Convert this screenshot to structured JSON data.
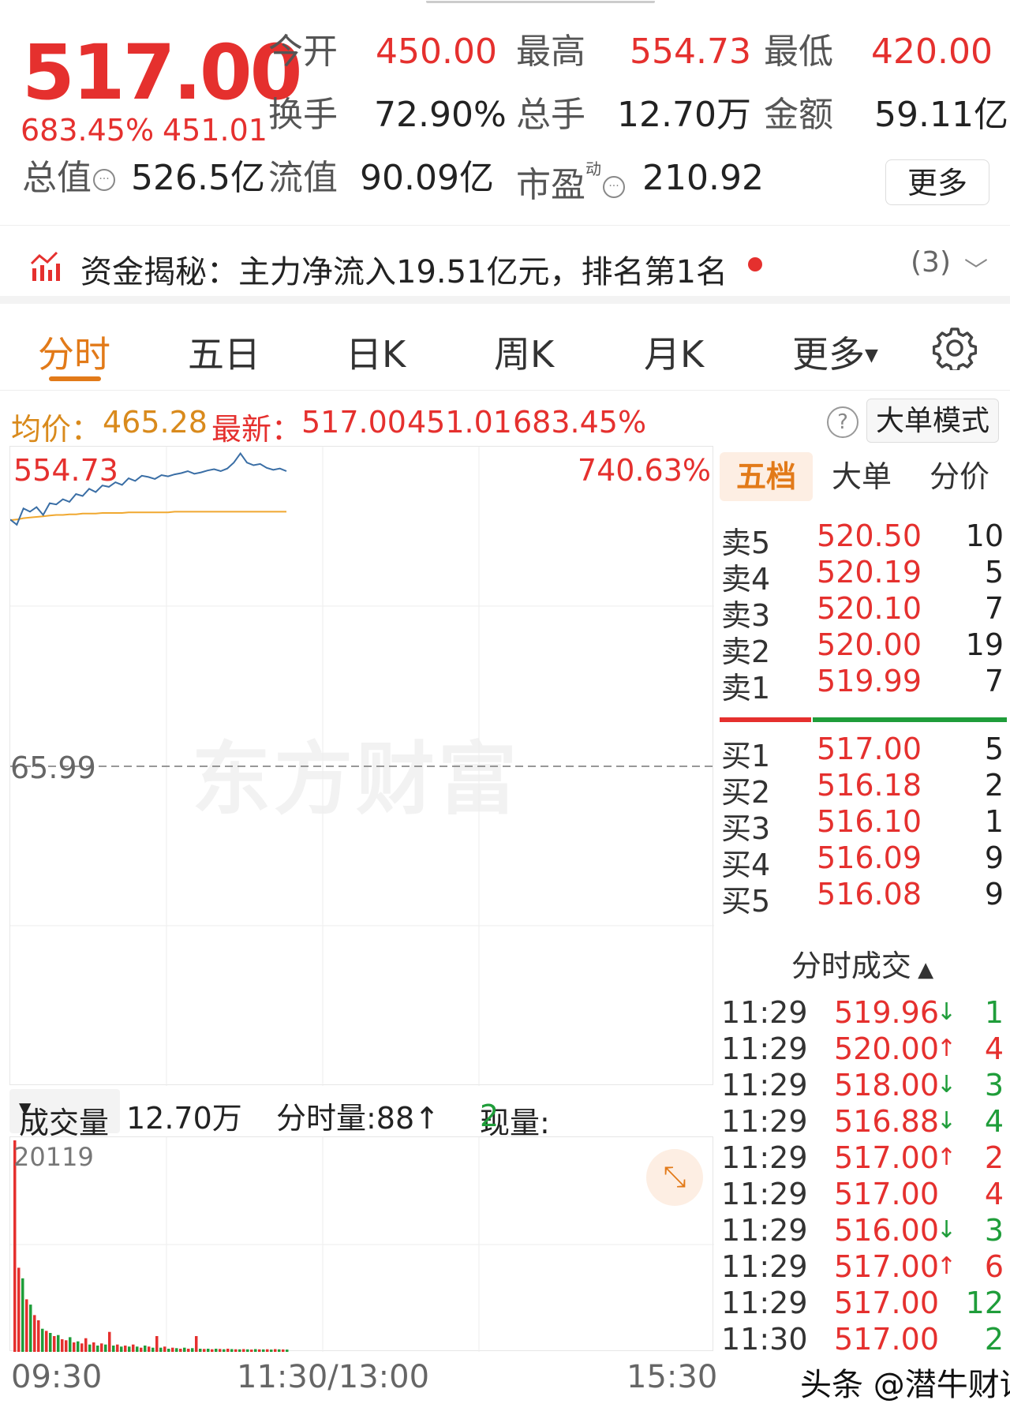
{
  "quote": {
    "price": "517.00",
    "change_pct": "683.45%",
    "change_abs": "451.01",
    "open_label": "今开",
    "open": "450.00",
    "high_label": "最高",
    "high": "554.73",
    "low_label": "最低",
    "low": "420.00",
    "turnover_label": "换手",
    "turnover": "72.90%",
    "volume_label": "总手",
    "volume": "12.70万",
    "amount_label": "金额",
    "amount": "59.11亿",
    "mktcap_label": "总值",
    "mktcap": "526.5亿",
    "float_label": "流值",
    "float": "90.09亿",
    "pe_label": "市盈",
    "pe_sup": "动",
    "pe": "210.92",
    "more_label": "更多"
  },
  "flow": {
    "text": "资金揭秘：主力净流入19.51亿元，排名第1名",
    "count": "(3)"
  },
  "tabs": [
    "分时",
    "五日",
    "日K",
    "周K",
    "月K",
    "更多"
  ],
  "strip": {
    "avg_label": "均价：",
    "avg": "465.28",
    "latest_label": "最新：",
    "latest": "517.00",
    "latest_chg": "451.01",
    "latest_pct": "683.45%",
    "mode_label": "大单模式"
  },
  "chart_labels": {
    "y_top": "554.73",
    "y_top_pct": "740.63%",
    "y_mid": "65.99",
    "watermark": "东方财富"
  },
  "volume_header": {
    "label": "成交量",
    "total": "12.70万",
    "period_vol": "分时量:88↑",
    "current_label": "现量:",
    "current": "2",
    "max": "20119"
  },
  "time_axis": [
    "09:30",
    "11:30/13:00",
    "15:30"
  ],
  "panel": {
    "tabs": [
      "五档",
      "大单",
      "分价"
    ],
    "asks": [
      {
        "label": "卖5",
        "price": "520.50",
        "qty": "10"
      },
      {
        "label": "卖4",
        "price": "520.19",
        "qty": "5"
      },
      {
        "label": "卖3",
        "price": "520.10",
        "qty": "7"
      },
      {
        "label": "卖2",
        "price": "520.00",
        "qty": "19"
      },
      {
        "label": "卖1",
        "price": "519.99",
        "qty": "7"
      }
    ],
    "bids": [
      {
        "label": "买1",
        "price": "517.00",
        "qty": "5"
      },
      {
        "label": "买2",
        "price": "516.18",
        "qty": "2"
      },
      {
        "label": "买3",
        "price": "516.10",
        "qty": "1"
      },
      {
        "label": "买4",
        "price": "516.09",
        "qty": "9"
      },
      {
        "label": "买5",
        "price": "516.08",
        "qty": "9"
      }
    ],
    "ticks_title": "分时成交",
    "ticks": [
      {
        "time": "11:29",
        "price": "519.96",
        "dir": "down",
        "qty": "1",
        "side": "buy"
      },
      {
        "time": "11:29",
        "price": "520.00",
        "dir": "up",
        "qty": "4",
        "side": "sell"
      },
      {
        "time": "11:29",
        "price": "518.00",
        "dir": "down",
        "qty": "3",
        "side": "buy"
      },
      {
        "time": "11:29",
        "price": "516.88",
        "dir": "down",
        "qty": "4",
        "side": "buy"
      },
      {
        "time": "11:29",
        "price": "517.00",
        "dir": "up",
        "qty": "2",
        "side": "sell"
      },
      {
        "time": "11:29",
        "price": "517.00",
        "dir": "",
        "qty": "4",
        "side": "sell"
      },
      {
        "time": "11:29",
        "price": "516.00",
        "dir": "down",
        "qty": "3",
        "side": "buy"
      },
      {
        "time": "11:29",
        "price": "517.00",
        "dir": "up",
        "qty": "6",
        "side": "sell"
      },
      {
        "time": "11:29",
        "price": "517.00",
        "dir": "",
        "qty": "12",
        "side": "buy"
      },
      {
        "time": "11:30",
        "price": "517.00",
        "dir": "",
        "qty": "2",
        "side": "buy"
      }
    ],
    "depth_bid_ratio": 0.32
  },
  "credit": "头条 @潜牛财评",
  "colors": {
    "up": "#e5302e",
    "down": "#1f9d3a",
    "accent": "#e27a19",
    "price_line": "#3a6ea5",
    "avg_line": "#f0a830"
  },
  "chart_data": {
    "type": "line",
    "x_start": "09:30",
    "x_end": "15:30",
    "ylim": [
      65.99,
      554.73
    ],
    "series": [
      {
        "values": [
          453,
          445,
          470,
          465,
          472,
          460,
          478,
          476,
          484,
          480,
          492,
          489,
          500,
          495,
          505,
          503,
          510,
          506,
          516,
          512,
          520,
          518,
          515,
          521,
          519,
          522,
          524,
          527,
          523,
          525,
          528,
          530,
          527,
          531,
          540,
          554,
          540,
          536,
          538,
          532,
          529,
          531,
          527
        ]
      },
      {
        "values": [
          452,
          453,
          455,
          456,
          457,
          458,
          459,
          460,
          460,
          461,
          461,
          462,
          462,
          462,
          463,
          463,
          463,
          463,
          464,
          464,
          464,
          464,
          464,
          464,
          464,
          465,
          465,
          465,
          465,
          465,
          465,
          465,
          465,
          465,
          465,
          465,
          465,
          465,
          465,
          465,
          465,
          465,
          465
        ]
      }
    ],
    "volume": {
      "max": 20119,
      "values": [
        20119,
        8000,
        7000,
        5000,
        4500,
        3500,
        3000,
        2200,
        2000,
        1800,
        1500,
        1600,
        1200,
        1100,
        1400,
        900,
        1000,
        800,
        1300,
        700,
        900,
        600,
        800,
        700,
        1900,
        600,
        700,
        500,
        600,
        500,
        700,
        500,
        400,
        600,
        500,
        400,
        1500,
        400,
        500,
        300,
        400,
        350,
        300,
        400,
        300,
        350,
        1500,
        300,
        280,
        300,
        250,
        300,
        280,
        250,
        300,
        260,
        250,
        240,
        260,
        240,
        220,
        260,
        240,
        230,
        250,
        220,
        260,
        240,
        230,
        220
      ],
      "colors": [
        "up",
        "up",
        "down",
        "up",
        "down",
        "up",
        "up",
        "down",
        "up",
        "down",
        "up",
        "down",
        "up",
        "up",
        "down",
        "up",
        "down",
        "up",
        "up",
        "down",
        "up",
        "down",
        "up",
        "down",
        "up",
        "down",
        "up",
        "down",
        "up",
        "down",
        "up",
        "down",
        "up",
        "down",
        "up",
        "down",
        "up",
        "down",
        "up",
        "down",
        "up",
        "down",
        "up",
        "down",
        "up",
        "down",
        "up",
        "down",
        "up",
        "down",
        "up",
        "down",
        "up",
        "down",
        "up",
        "down",
        "up",
        "down",
        "up",
        "down",
        "up",
        "down",
        "up",
        "down",
        "up",
        "down",
        "up",
        "down",
        "up",
        "down"
      ]
    }
  }
}
